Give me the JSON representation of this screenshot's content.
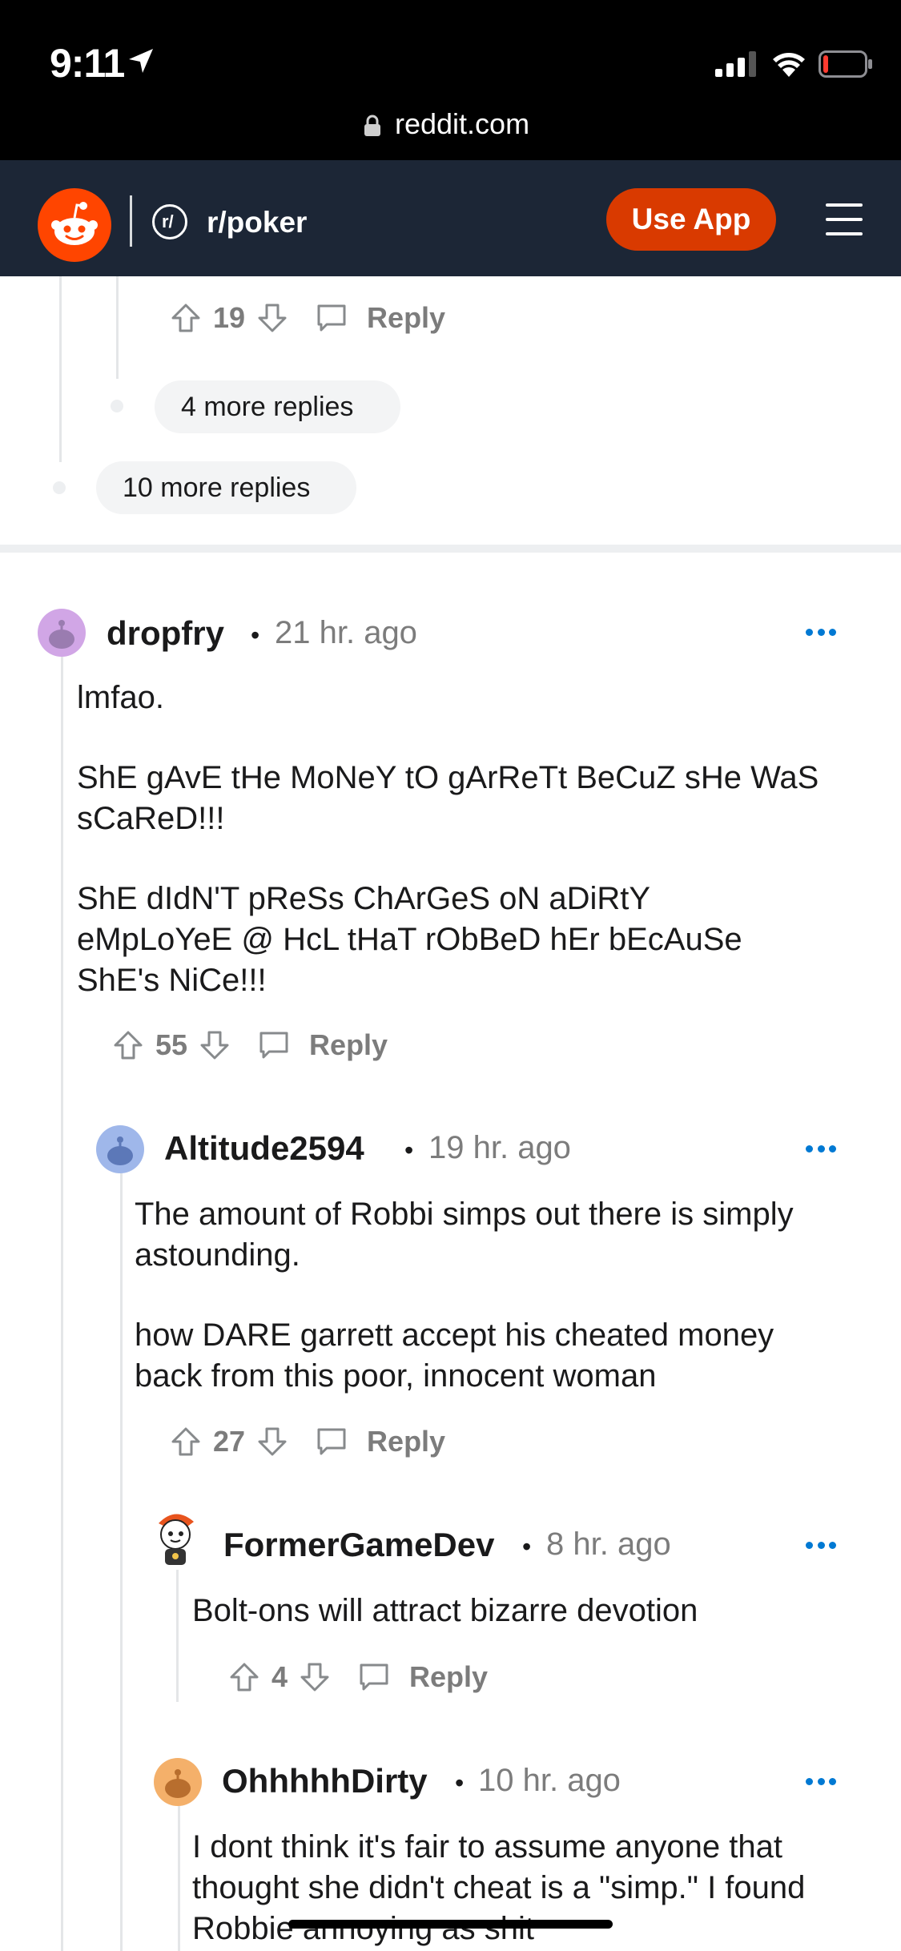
{
  "status_bar": {
    "time": "9:11",
    "url": "reddit.com"
  },
  "header": {
    "subreddit": "r/poker",
    "use_app_label": "Use App"
  },
  "top_thread": {
    "nested_vote_count": "19",
    "reply_label": "Reply",
    "nested_more_replies": "4 more replies",
    "outer_more_replies": "10 more replies"
  },
  "comments": [
    {
      "username": "dropfry",
      "time": "21 hr. ago",
      "paragraphs": [
        "lmfao.",
        "ShE gAvE tHe MoNeY tO gArReTt BeCuZ sHe WaS sCaReD!!!",
        "ShE dIdN'T pReSs ChArGeS oN aDiRtY eMpLoYeE @ HcL tHaT rObBeD hEr bEcAuSe ShE's NiCe!!!"
      ],
      "votes": "55",
      "reply_label": "Reply"
    },
    {
      "username": "Altitude2594",
      "time": "19 hr. ago",
      "paragraphs": [
        "The amount of Robbi simps out there is simply astounding.",
        "how DARE garrett accept his cheated money back from this poor, innocent woman"
      ],
      "votes": "27",
      "reply_label": "Reply"
    },
    {
      "username": "FormerGameDev",
      "time": "8 hr. ago",
      "paragraphs": [
        "Bolt-ons will attract bizarre devotion"
      ],
      "votes": "4",
      "reply_label": "Reply"
    },
    {
      "username": "OhhhhhDirty",
      "time": "10 hr. ago",
      "paragraphs": [
        "I dont think it's fair to assume anyone that thought she didn't cheat is a \"simp.\" I found Robbie annoying as shit"
      ]
    }
  ],
  "colors": {
    "reddit_orange": "#ff4500",
    "use_app_bg": "#d93a00",
    "header_bg": "#1c2636",
    "meta_gray": "#7c7c7c",
    "more_blue": "#0079d3"
  }
}
